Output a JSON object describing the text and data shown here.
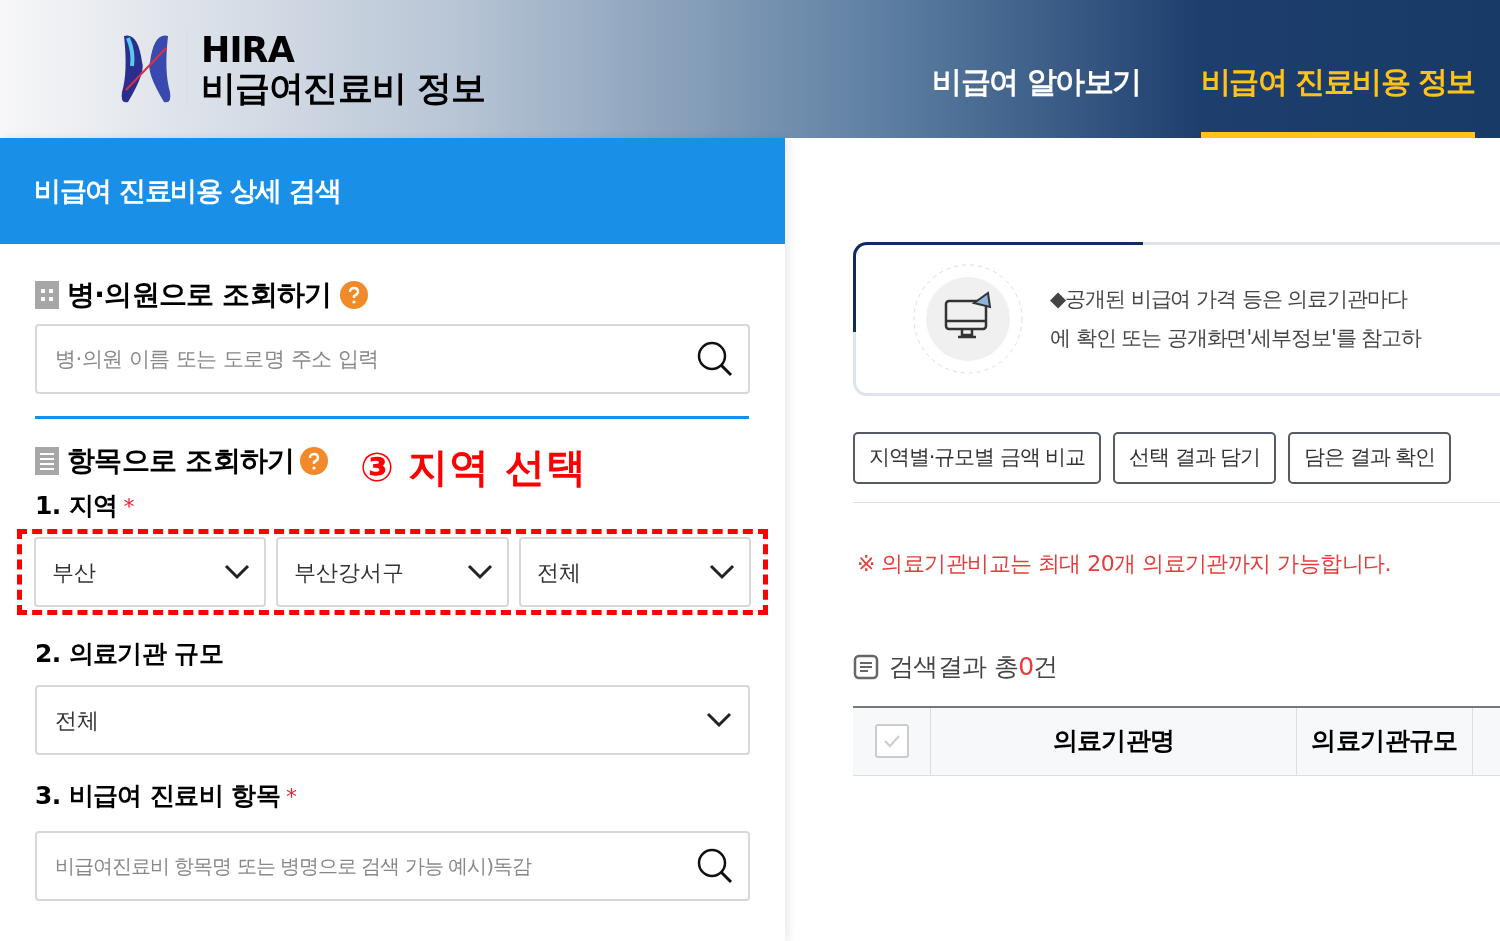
{
  "header": {
    "brand": "HIRA",
    "brand_subtitle": "비급여진료비 정보",
    "nav": [
      {
        "label": "비급여 알아보기",
        "selected": false
      },
      {
        "label": "비급여 진료비용 정보",
        "selected": true
      }
    ]
  },
  "search_panel": {
    "title": "비급여 진료비용 상세 검색",
    "hospital_search": {
      "heading": "병·의원으로 조회하기",
      "placeholder": "병·의원 이름 또는 도로명 주소 입력"
    },
    "item_search": {
      "heading": "항목으로 조회하기",
      "annotation": {
        "number": "③",
        "text": "지역 선택"
      },
      "region": {
        "label": "1. 지역",
        "required": "*",
        "selects": [
          "부산",
          "부산강서구",
          "전체"
        ]
      },
      "scale": {
        "label": "2. 의료기관 규모",
        "select": "전체"
      },
      "item": {
        "label": "3. 비급여 진료비 항목",
        "required": "*",
        "placeholder": "비급여진료비 항목명 또는 병명으로 검색 가능 예시)독감"
      }
    }
  },
  "results": {
    "notice": [
      "◆공개된 비급여 가격 등은 의료기관마다",
      "에 확인 또는 공개화면'세부정보'를 참고하"
    ],
    "buttons": [
      "지역별·규모별 금액 비교",
      "선택 결과 담기",
      "담은 결과 확인"
    ],
    "limit_note": "※ 의료기관비교는 최대 20개 의료기관까지 가능합니다.",
    "count": {
      "label": "검색결과 총",
      "value": "0",
      "unit": "건"
    },
    "table": {
      "select_all_checked": false,
      "columns": [
        "의료기관명",
        "의료기관규모"
      ]
    }
  }
}
